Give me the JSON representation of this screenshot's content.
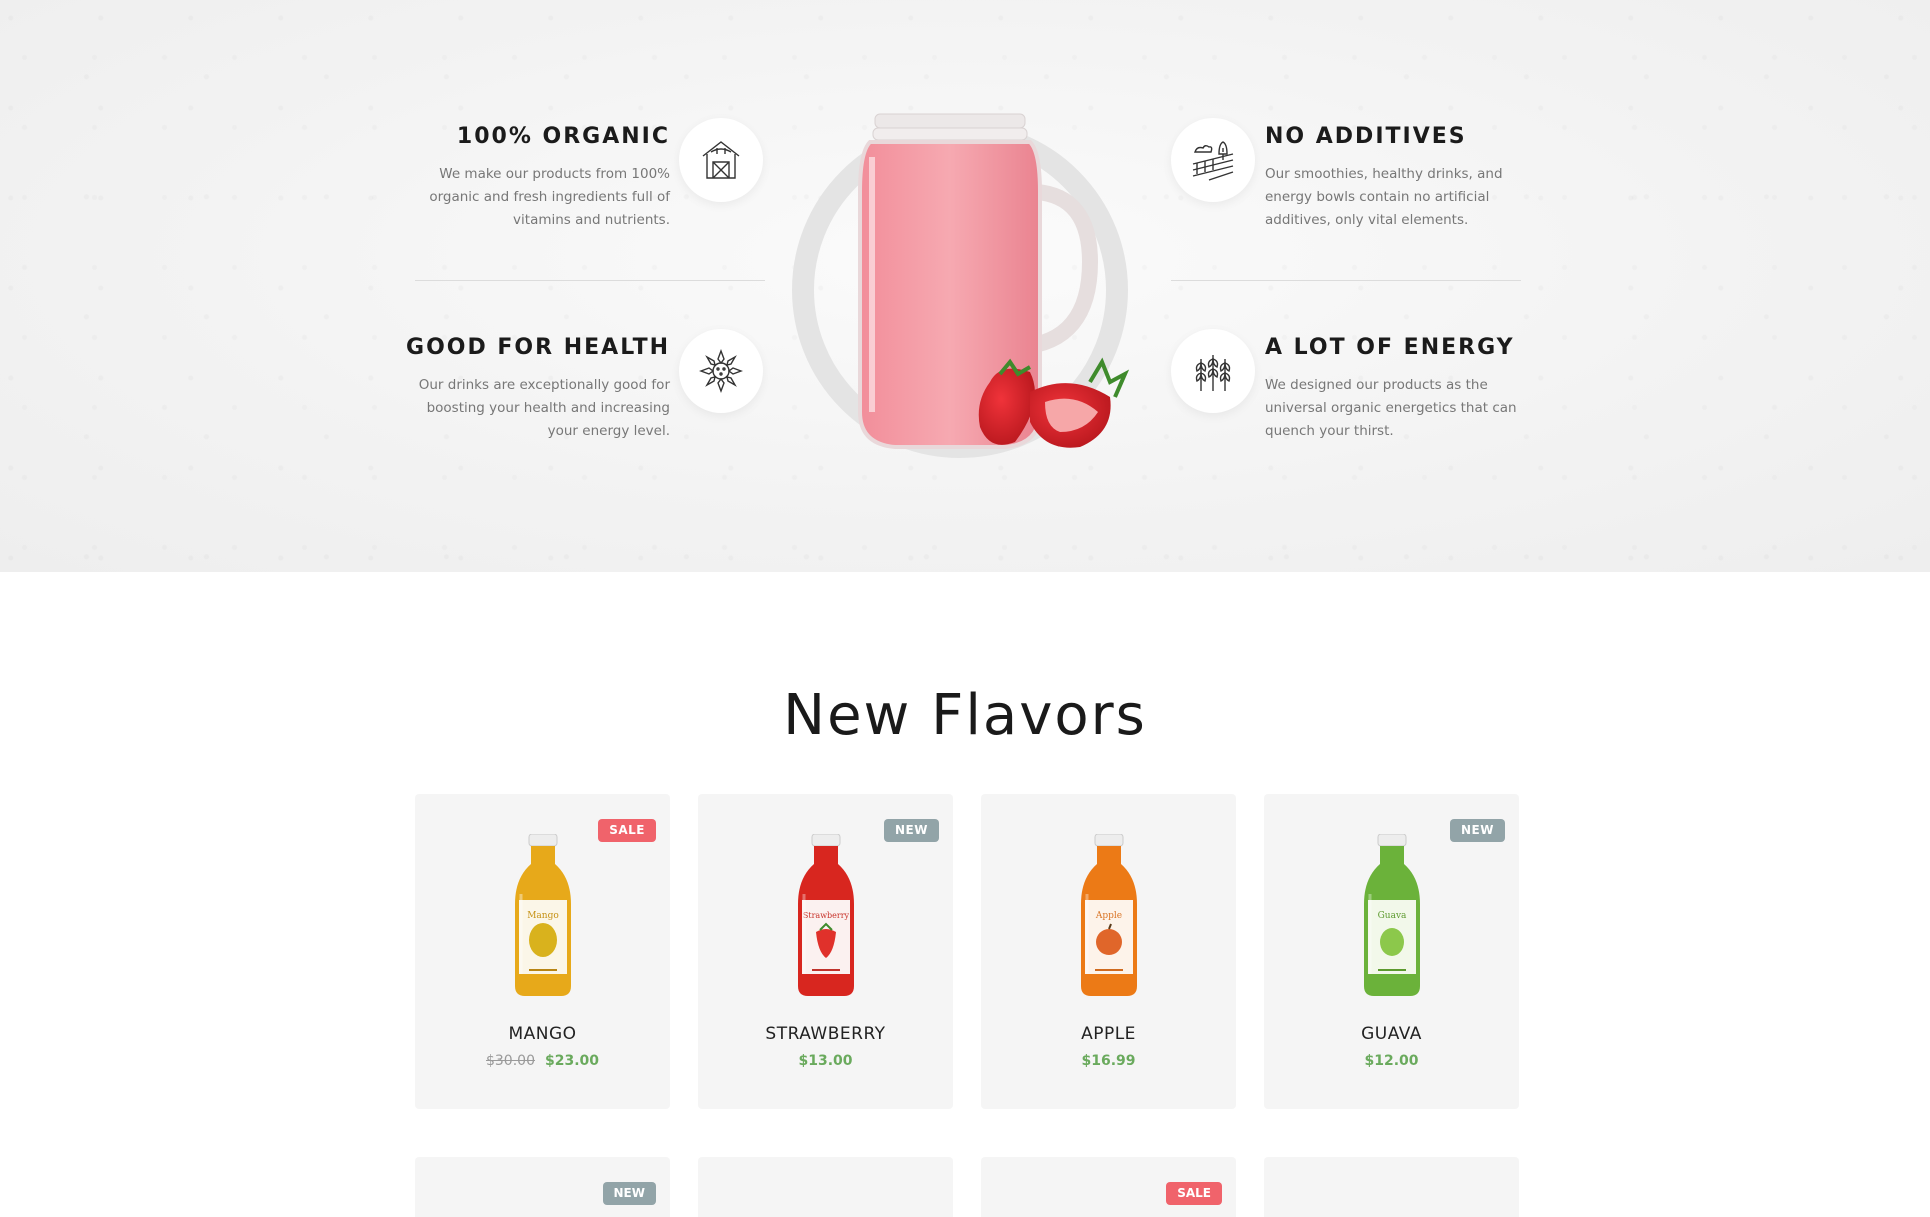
{
  "features": {
    "organic": {
      "title": "100% ORGANIC",
      "desc": "We make our products from 100% organic and fresh ingredients full of vitamins and nutrients.",
      "icon": "barn-icon"
    },
    "health": {
      "title": "GOOD FOR HEALTH",
      "desc": "Our drinks are exceptionally good for boosting your health and increasing your energy level.",
      "icon": "sunflower-icon"
    },
    "additives": {
      "title": "NO ADDITIVES",
      "desc": "Our smoothies, healthy drinks, and energy bowls contain no artificial additives, only vital elements.",
      "icon": "farm-field-icon"
    },
    "energy": {
      "title": "A LOT OF ENERGY",
      "desc": "We designed our products as the universal organic energetics that can quench your thirst.",
      "icon": "wheat-icon"
    }
  },
  "new_flavors": {
    "title": "New Flavors",
    "products": [
      {
        "name": "MANGO",
        "badge": "SALE",
        "old_price": "$30.00",
        "price": "$23.00",
        "bottle_color": "#e7a91a",
        "label_text": "Mango"
      },
      {
        "name": "STRAWBERRY",
        "badge": "NEW",
        "old_price": "",
        "price": "$13.00",
        "bottle_color": "#d8261f",
        "label_text": "Strawberry"
      },
      {
        "name": "APPLE",
        "badge": "",
        "old_price": "",
        "price": "$16.99",
        "bottle_color": "#ec7a16",
        "label_text": "Apple"
      },
      {
        "name": "GUAVA",
        "badge": "NEW",
        "old_price": "",
        "price": "$12.00",
        "bottle_color": "#6bb23a",
        "label_text": "Guava"
      }
    ],
    "next_row_badges": [
      "NEW",
      "",
      "SALE",
      ""
    ]
  },
  "colors": {
    "sale": "#f0636b",
    "new": "#92a4a8",
    "price": "#6aaa5d"
  }
}
